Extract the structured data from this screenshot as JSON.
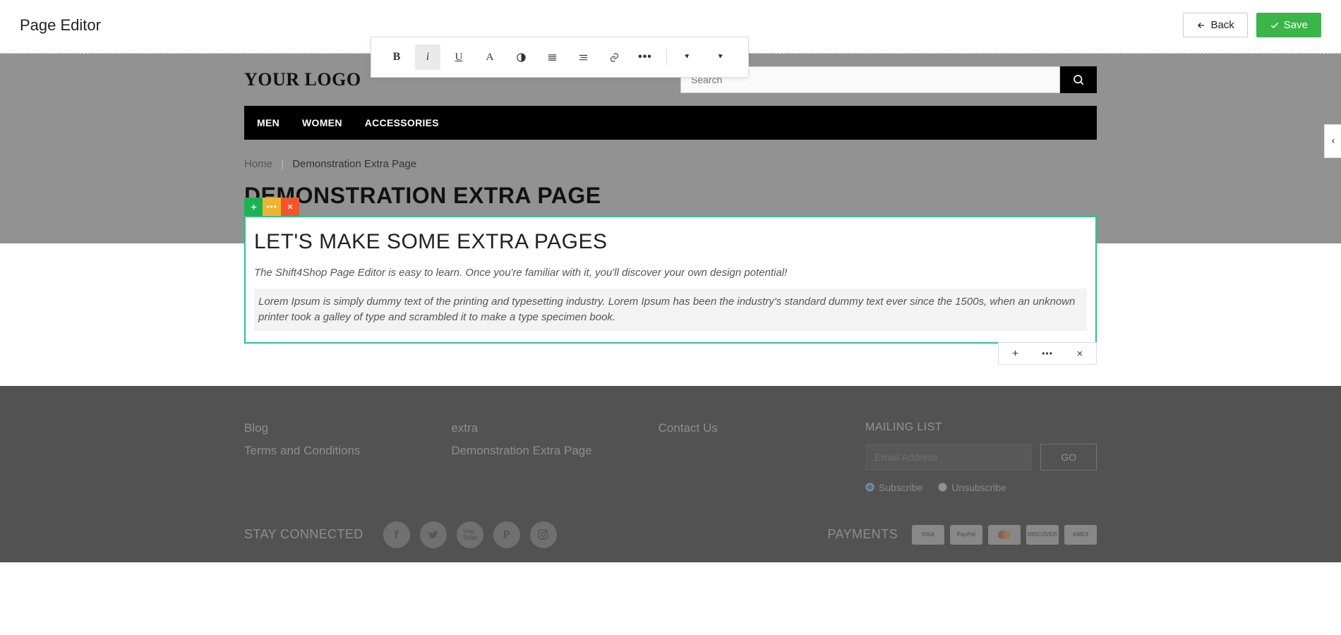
{
  "editor": {
    "title": "Page Editor",
    "back_label": "Back",
    "save_label": "Save"
  },
  "site": {
    "logo": "YOUR LOGO",
    "search_placeholder": "Search"
  },
  "nav": {
    "items": [
      "MEN",
      "WOMEN",
      "ACCESSORIES"
    ]
  },
  "breadcrumb": {
    "home": "Home",
    "current": "Demonstration Extra Page"
  },
  "page": {
    "heading": "DEMONSTRATION EXTRA PAGE"
  },
  "block": {
    "title": "LET'S MAKE SOME EXTRA PAGES",
    "intro": "The Shift4Shop Page Editor is easy to learn. Once you're familiar with it, you'll discover your own design potential!",
    "body": "Lorem Ipsum is simply dummy text of the printing and typesetting industry. Lorem Ipsum has been the industry's standard dummy text ever since the 1500s, when an unknown printer took a galley of type and scrambled it to make a type specimen book."
  },
  "footer": {
    "col1": [
      "Blog",
      "Terms and Conditions"
    ],
    "col2": [
      "extra",
      "Demonstration Extra Page"
    ],
    "col3": [
      "Contact Us"
    ],
    "mailing_title": "MAILING LIST",
    "mailing_placeholder": "Email Address",
    "go_label": "GO",
    "subscribe": "Subscribe",
    "unsubscribe": "Unsubscribe",
    "stay_connected": "STAY CONNECTED",
    "payments_label": "PAYMENTS",
    "payment_brands": [
      "VISA",
      "PayPal",
      "MC",
      "DISCOVER",
      "AMEX"
    ]
  },
  "toolbar": {
    "icons": [
      "bold",
      "italic",
      "underline",
      "font",
      "contrast",
      "align",
      "indent",
      "link",
      "more",
      "undo",
      "redo"
    ],
    "active": "italic"
  }
}
